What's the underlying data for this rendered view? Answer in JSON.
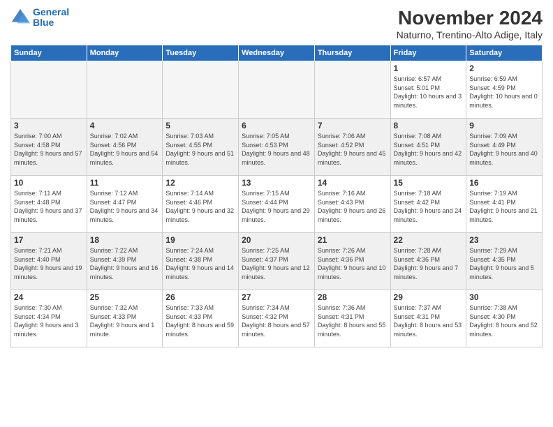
{
  "header": {
    "logo_line1": "General",
    "logo_line2": "Blue",
    "month_title": "November 2024",
    "location": "Naturno, Trentino-Alto Adige, Italy"
  },
  "days_of_week": [
    "Sunday",
    "Monday",
    "Tuesday",
    "Wednesday",
    "Thursday",
    "Friday",
    "Saturday"
  ],
  "weeks": [
    [
      {
        "day": "",
        "sunrise": "",
        "sunset": "",
        "daylight": "",
        "empty": true
      },
      {
        "day": "",
        "sunrise": "",
        "sunset": "",
        "daylight": "",
        "empty": true
      },
      {
        "day": "",
        "sunrise": "",
        "sunset": "",
        "daylight": "",
        "empty": true
      },
      {
        "day": "",
        "sunrise": "",
        "sunset": "",
        "daylight": "",
        "empty": true
      },
      {
        "day": "",
        "sunrise": "",
        "sunset": "",
        "daylight": "",
        "empty": true
      },
      {
        "day": "1",
        "sunrise": "Sunrise: 6:57 AM",
        "sunset": "Sunset: 5:01 PM",
        "daylight": "Daylight: 10 hours and 3 minutes."
      },
      {
        "day": "2",
        "sunrise": "Sunrise: 6:59 AM",
        "sunset": "Sunset: 4:59 PM",
        "daylight": "Daylight: 10 hours and 0 minutes."
      }
    ],
    [
      {
        "day": "3",
        "sunrise": "Sunrise: 7:00 AM",
        "sunset": "Sunset: 4:58 PM",
        "daylight": "Daylight: 9 hours and 57 minutes."
      },
      {
        "day": "4",
        "sunrise": "Sunrise: 7:02 AM",
        "sunset": "Sunset: 4:56 PM",
        "daylight": "Daylight: 9 hours and 54 minutes."
      },
      {
        "day": "5",
        "sunrise": "Sunrise: 7:03 AM",
        "sunset": "Sunset: 4:55 PM",
        "daylight": "Daylight: 9 hours and 51 minutes."
      },
      {
        "day": "6",
        "sunrise": "Sunrise: 7:05 AM",
        "sunset": "Sunset: 4:53 PM",
        "daylight": "Daylight: 9 hours and 48 minutes."
      },
      {
        "day": "7",
        "sunrise": "Sunrise: 7:06 AM",
        "sunset": "Sunset: 4:52 PM",
        "daylight": "Daylight: 9 hours and 45 minutes."
      },
      {
        "day": "8",
        "sunrise": "Sunrise: 7:08 AM",
        "sunset": "Sunset: 4:51 PM",
        "daylight": "Daylight: 9 hours and 42 minutes."
      },
      {
        "day": "9",
        "sunrise": "Sunrise: 7:09 AM",
        "sunset": "Sunset: 4:49 PM",
        "daylight": "Daylight: 9 hours and 40 minutes."
      }
    ],
    [
      {
        "day": "10",
        "sunrise": "Sunrise: 7:11 AM",
        "sunset": "Sunset: 4:48 PM",
        "daylight": "Daylight: 9 hours and 37 minutes."
      },
      {
        "day": "11",
        "sunrise": "Sunrise: 7:12 AM",
        "sunset": "Sunset: 4:47 PM",
        "daylight": "Daylight: 9 hours and 34 minutes."
      },
      {
        "day": "12",
        "sunrise": "Sunrise: 7:14 AM",
        "sunset": "Sunset: 4:46 PM",
        "daylight": "Daylight: 9 hours and 32 minutes."
      },
      {
        "day": "13",
        "sunrise": "Sunrise: 7:15 AM",
        "sunset": "Sunset: 4:44 PM",
        "daylight": "Daylight: 9 hours and 29 minutes."
      },
      {
        "day": "14",
        "sunrise": "Sunrise: 7:16 AM",
        "sunset": "Sunset: 4:43 PM",
        "daylight": "Daylight: 9 hours and 26 minutes."
      },
      {
        "day": "15",
        "sunrise": "Sunrise: 7:18 AM",
        "sunset": "Sunset: 4:42 PM",
        "daylight": "Daylight: 9 hours and 24 minutes."
      },
      {
        "day": "16",
        "sunrise": "Sunrise: 7:19 AM",
        "sunset": "Sunset: 4:41 PM",
        "daylight": "Daylight: 9 hours and 21 minutes."
      }
    ],
    [
      {
        "day": "17",
        "sunrise": "Sunrise: 7:21 AM",
        "sunset": "Sunset: 4:40 PM",
        "daylight": "Daylight: 9 hours and 19 minutes."
      },
      {
        "day": "18",
        "sunrise": "Sunrise: 7:22 AM",
        "sunset": "Sunset: 4:39 PM",
        "daylight": "Daylight: 9 hours and 16 minutes."
      },
      {
        "day": "19",
        "sunrise": "Sunrise: 7:24 AM",
        "sunset": "Sunset: 4:38 PM",
        "daylight": "Daylight: 9 hours and 14 minutes."
      },
      {
        "day": "20",
        "sunrise": "Sunrise: 7:25 AM",
        "sunset": "Sunset: 4:37 PM",
        "daylight": "Daylight: 9 hours and 12 minutes."
      },
      {
        "day": "21",
        "sunrise": "Sunrise: 7:26 AM",
        "sunset": "Sunset: 4:36 PM",
        "daylight": "Daylight: 9 hours and 10 minutes."
      },
      {
        "day": "22",
        "sunrise": "Sunrise: 7:28 AM",
        "sunset": "Sunset: 4:36 PM",
        "daylight": "Daylight: 9 hours and 7 minutes."
      },
      {
        "day": "23",
        "sunrise": "Sunrise: 7:29 AM",
        "sunset": "Sunset: 4:35 PM",
        "daylight": "Daylight: 9 hours and 5 minutes."
      }
    ],
    [
      {
        "day": "24",
        "sunrise": "Sunrise: 7:30 AM",
        "sunset": "Sunset: 4:34 PM",
        "daylight": "Daylight: 9 hours and 3 minutes."
      },
      {
        "day": "25",
        "sunrise": "Sunrise: 7:32 AM",
        "sunset": "Sunset: 4:33 PM",
        "daylight": "Daylight: 9 hours and 1 minute."
      },
      {
        "day": "26",
        "sunrise": "Sunrise: 7:33 AM",
        "sunset": "Sunset: 4:33 PM",
        "daylight": "Daylight: 8 hours and 59 minutes."
      },
      {
        "day": "27",
        "sunrise": "Sunrise: 7:34 AM",
        "sunset": "Sunset: 4:32 PM",
        "daylight": "Daylight: 8 hours and 57 minutes."
      },
      {
        "day": "28",
        "sunrise": "Sunrise: 7:36 AM",
        "sunset": "Sunset: 4:31 PM",
        "daylight": "Daylight: 8 hours and 55 minutes."
      },
      {
        "day": "29",
        "sunrise": "Sunrise: 7:37 AM",
        "sunset": "Sunset: 4:31 PM",
        "daylight": "Daylight: 8 hours and 53 minutes."
      },
      {
        "day": "30",
        "sunrise": "Sunrise: 7:38 AM",
        "sunset": "Sunset: 4:30 PM",
        "daylight": "Daylight: 8 hours and 52 minutes."
      }
    ]
  ]
}
